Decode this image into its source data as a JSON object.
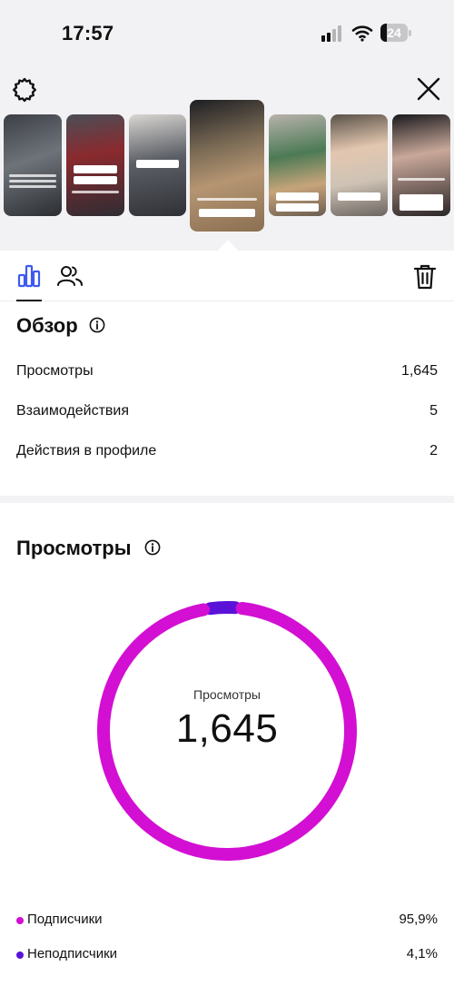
{
  "status_bar": {
    "time": "17:57",
    "battery_level": "24"
  },
  "overview": {
    "title": "Обзор",
    "rows": [
      {
        "label": "Просмотры",
        "value": "1,645"
      },
      {
        "label": "Взаимодействия",
        "value": "5"
      },
      {
        "label": "Действия в профиле",
        "value": "2"
      }
    ]
  },
  "views": {
    "title": "Просмотры",
    "center_label": "Просмотры",
    "center_value": "1,645"
  },
  "chart_data": {
    "type": "pie",
    "total": 1645,
    "series": [
      {
        "name": "Подписчики",
        "value": 95.9,
        "value_label": "95,9%",
        "color": "#d30fd3"
      },
      {
        "name": "Неподписчики",
        "value": 4.1,
        "value_label": "4,1%",
        "color": "#5a12d8"
      }
    ]
  },
  "icons": {
    "settings": "gear-icon",
    "close": "close-icon",
    "insights_tab": "bar-chart-icon",
    "audience_tab": "people-icon",
    "delete": "trash-icon",
    "info": "info-icon"
  },
  "colors": {
    "accent": "#3d5af1",
    "followers": "#d30fd3",
    "non_followers": "#5a12d8"
  }
}
